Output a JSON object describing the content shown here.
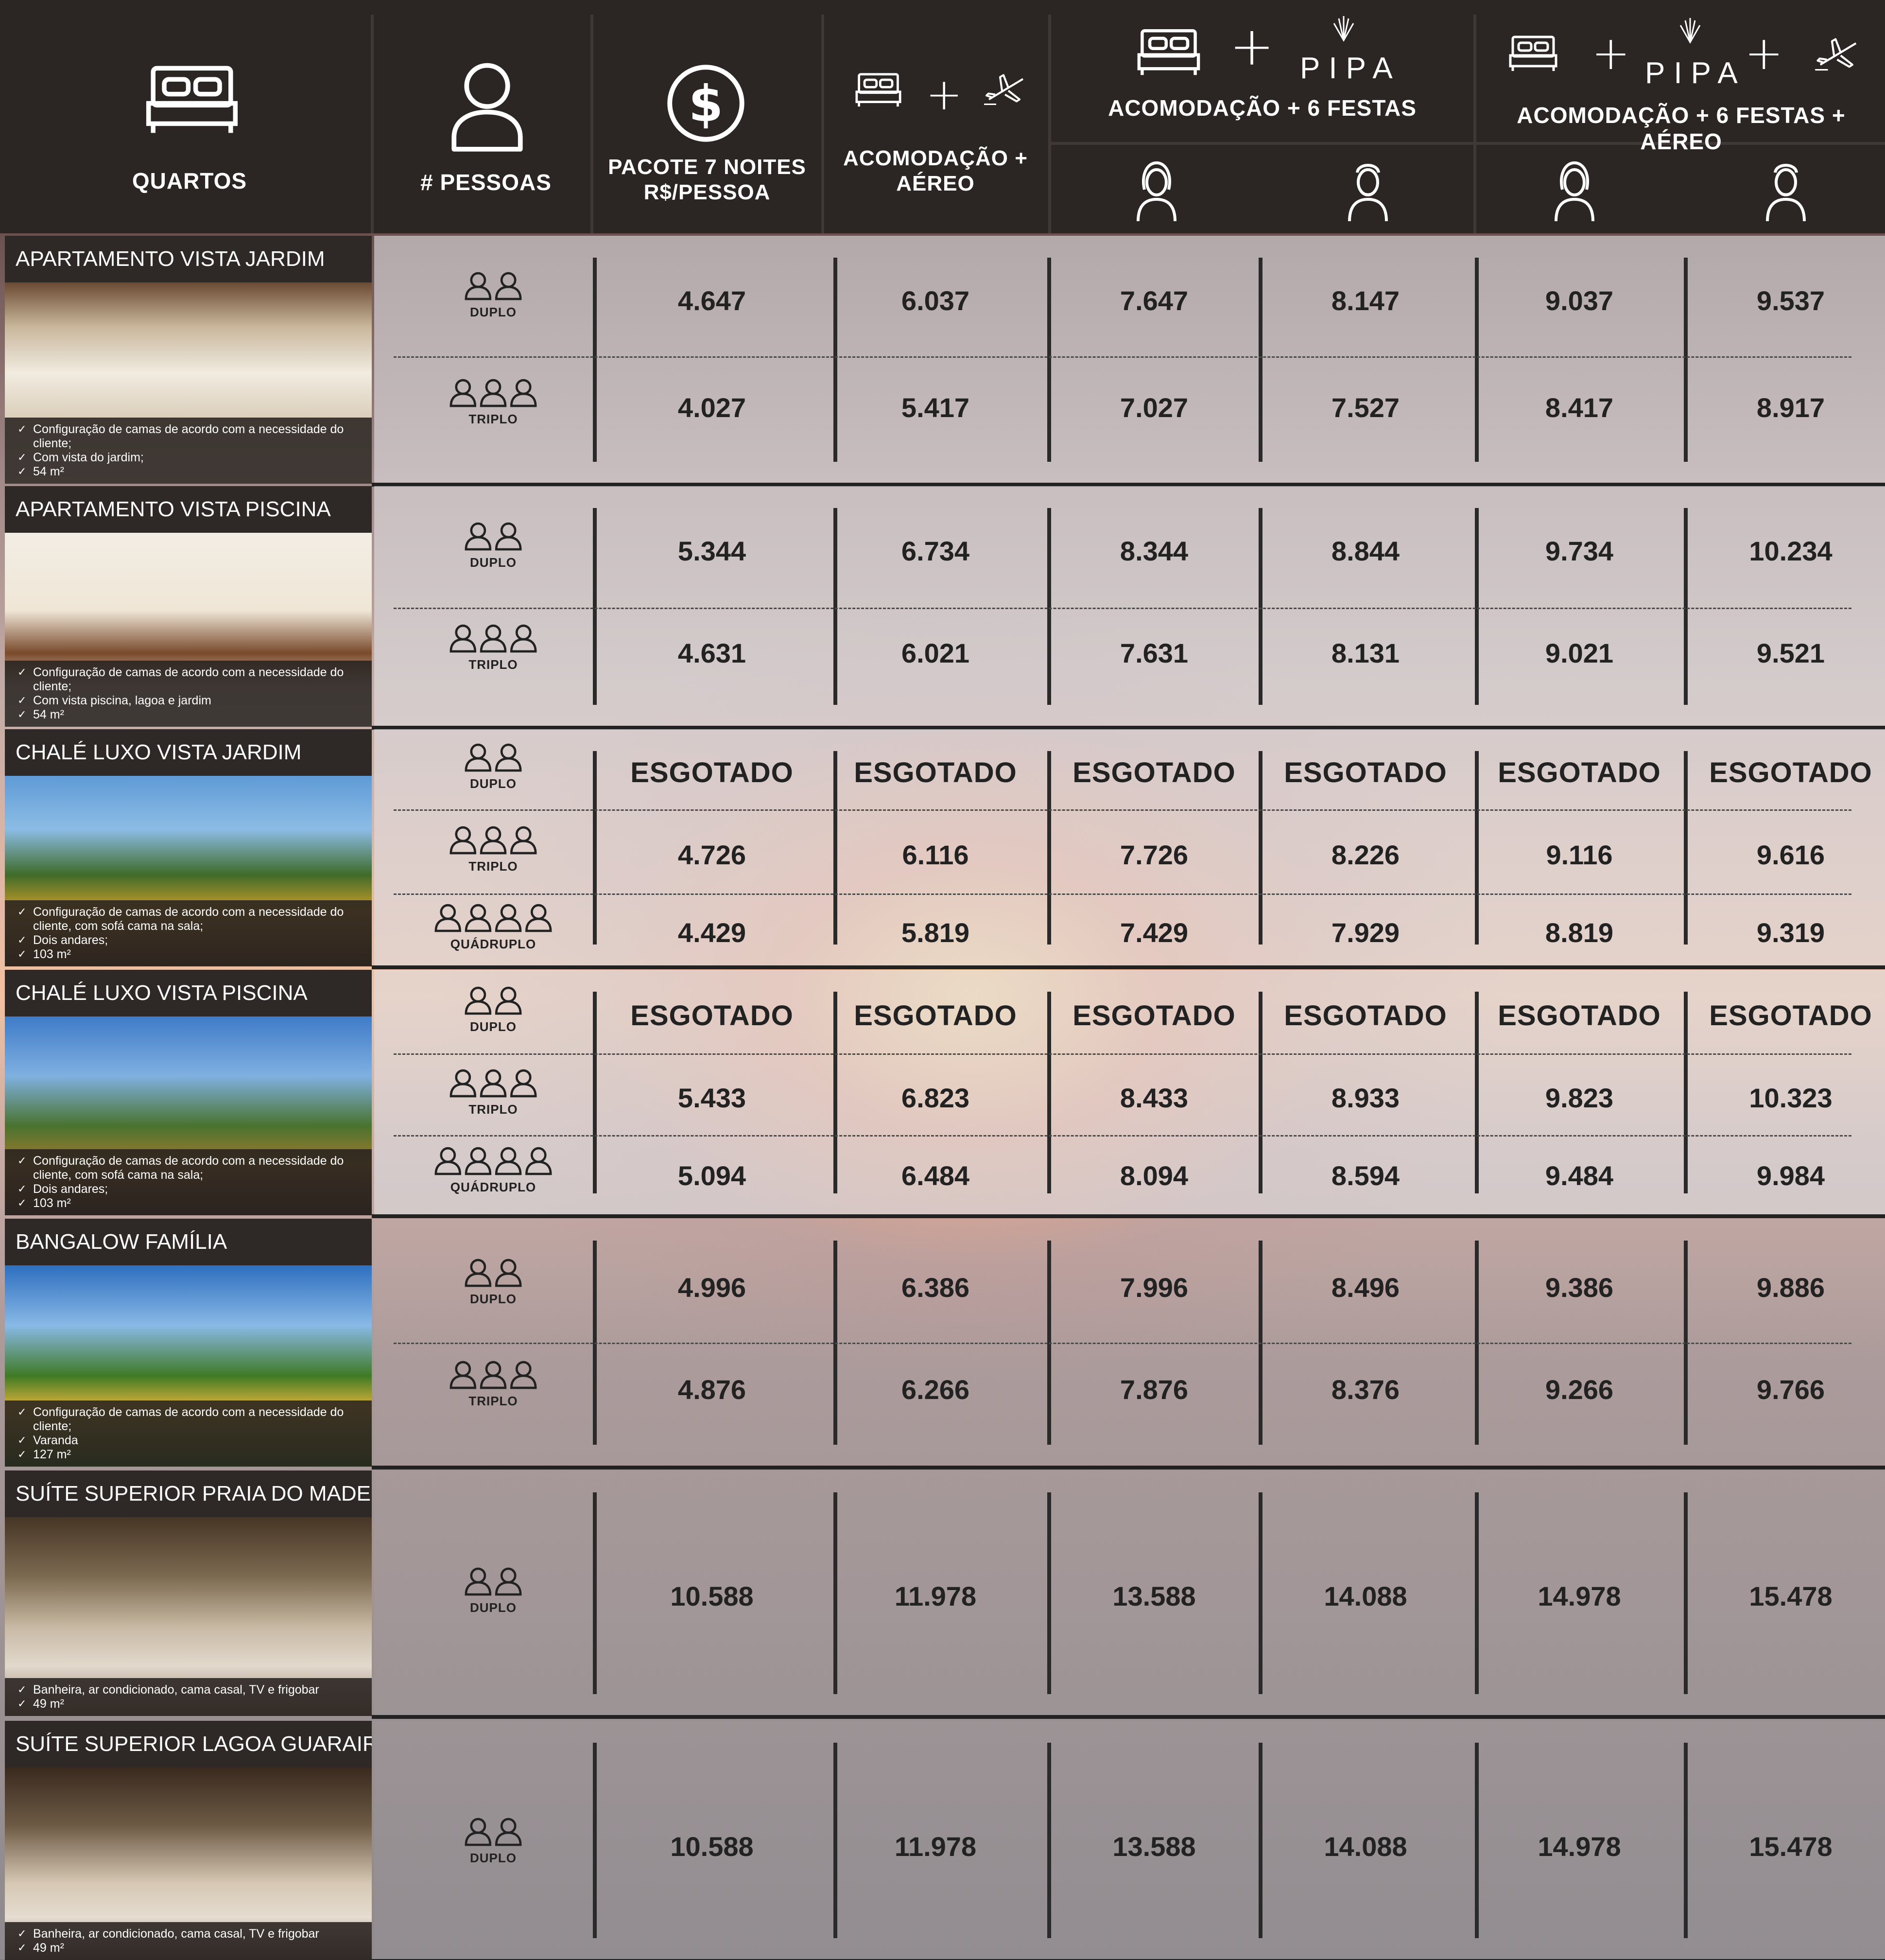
{
  "header": {
    "quartos": "QUARTOS",
    "pessoas": "# PESSOAS",
    "pacote_line1": "PACOTE 7 NOITES",
    "pacote_line2": "R$/PESSOA",
    "acomod_aereo_line1": "ACOMODAÇÃO +",
    "acomod_aereo_line2": "AÉREO",
    "acomod_festas": "ACOMODAÇÃO + 6 FESTAS",
    "acomod_festas_aereo": "ACOMODAÇÃO + 6 FESTAS + AÉREO",
    "pipa_brand": "PIPA",
    "plus": "+"
  },
  "occupancy_labels": {
    "duplo": "DUPLO",
    "triplo": "TRIPLO",
    "quadruplo": "QUÁDRUPLO"
  },
  "sold_out": "ESGOTADO",
  "rooms": [
    {
      "name": "APARTAMENTO VISTA JARDIM",
      "features": [
        "Configuração de camas de acordo com a necessidade do cliente;",
        "Com vista do jardim;",
        "54 m²"
      ],
      "rows": [
        {
          "occupancy": "DUPLO",
          "prices": [
            "4.647",
            "6.037",
            "7.647",
            "8.147",
            "9.037",
            "9.537"
          ]
        },
        {
          "occupancy": "TRIPLO",
          "prices": [
            "4.027",
            "5.417",
            "7.027",
            "7.527",
            "8.417",
            "8.917"
          ]
        }
      ]
    },
    {
      "name": "APARTAMENTO VISTA PISCINA",
      "features": [
        "Configuração de camas de acordo com a necessidade do cliente;",
        "Com vista piscina, lagoa e jardim",
        "54 m²"
      ],
      "rows": [
        {
          "occupancy": "DUPLO",
          "prices": [
            "5.344",
            "6.734",
            "8.344",
            "8.844",
            "9.734",
            "10.234"
          ]
        },
        {
          "occupancy": "TRIPLO",
          "prices": [
            "4.631",
            "6.021",
            "7.631",
            "8.131",
            "9.021",
            "9.521"
          ]
        }
      ]
    },
    {
      "name": "CHALÉ LUXO VISTA JARDIM",
      "features": [
        "Configuração de camas de acordo com a necessidade do cliente, com sofá cama na sala;",
        "Dois andares;",
        "103 m²"
      ],
      "rows": [
        {
          "occupancy": "DUPLO",
          "prices": [
            "ESGOTADO",
            "ESGOTADO",
            "ESGOTADO",
            "ESGOTADO",
            "ESGOTADO",
            "ESGOTADO"
          ]
        },
        {
          "occupancy": "TRIPLO",
          "prices": [
            "4.726",
            "6.116",
            "7.726",
            "8.226",
            "9.116",
            "9.616"
          ]
        },
        {
          "occupancy": "QUÁDRUPLO",
          "prices": [
            "4.429",
            "5.819",
            "7.429",
            "7.929",
            "8.819",
            "9.319"
          ]
        }
      ]
    },
    {
      "name": "CHALÉ LUXO VISTA PISCINA",
      "features": [
        "Configuração de camas de acordo com a necessidade do cliente, com sofá cama na sala;",
        "Dois andares;",
        "103 m²"
      ],
      "rows": [
        {
          "occupancy": "DUPLO",
          "prices": [
            "ESGOTADO",
            "ESGOTADO",
            "ESGOTADO",
            "ESGOTADO",
            "ESGOTADO",
            "ESGOTADO"
          ]
        },
        {
          "occupancy": "TRIPLO",
          "prices": [
            "5.433",
            "6.823",
            "8.433",
            "8.933",
            "9.823",
            "10.323"
          ]
        },
        {
          "occupancy": "QUÁDRUPLO",
          "prices": [
            "5.094",
            "6.484",
            "8.094",
            "8.594",
            "9.484",
            "9.984"
          ]
        }
      ]
    },
    {
      "name": "BANGALOW FAMÍLIA",
      "features": [
        "Configuração de camas de acordo com a necessidade do cliente;",
        "Varanda",
        "127 m²"
      ],
      "rows": [
        {
          "occupancy": "DUPLO",
          "prices": [
            "4.996",
            "6.386",
            "7.996",
            "8.496",
            "9.386",
            "9.886"
          ]
        },
        {
          "occupancy": "TRIPLO",
          "prices": [
            "4.876",
            "6.266",
            "7.876",
            "8.376",
            "9.266",
            "9.766"
          ]
        }
      ]
    },
    {
      "name": "SUÍTE SUPERIOR PRAIA DO MADEIRO",
      "features": [
        "Banheira, ar condicionado, cama casal, TV e frigobar",
        "49 m²"
      ],
      "rows": [
        {
          "occupancy": "DUPLO",
          "prices": [
            "10.588",
            "11.978",
            "13.588",
            "14.088",
            "14.978",
            "15.478"
          ]
        }
      ]
    },
    {
      "name": "SUÍTE SUPERIOR LAGOA GUARAIRAS",
      "features": [
        "Banheira, ar condicionado, cama casal, TV e frigobar",
        "49 m²"
      ],
      "rows": [
        {
          "occupancy": "DUPLO",
          "prices": [
            "10.588",
            "11.978",
            "13.588",
            "14.088",
            "14.978",
            "15.478"
          ]
        }
      ]
    }
  ],
  "icons": {
    "bed": "bed-icon",
    "person": "person-icon",
    "dollar": "dollar-icon",
    "airplane": "airplane-icon",
    "woman": "woman-icon",
    "man": "man-icon",
    "group": "people-group-icon"
  }
}
